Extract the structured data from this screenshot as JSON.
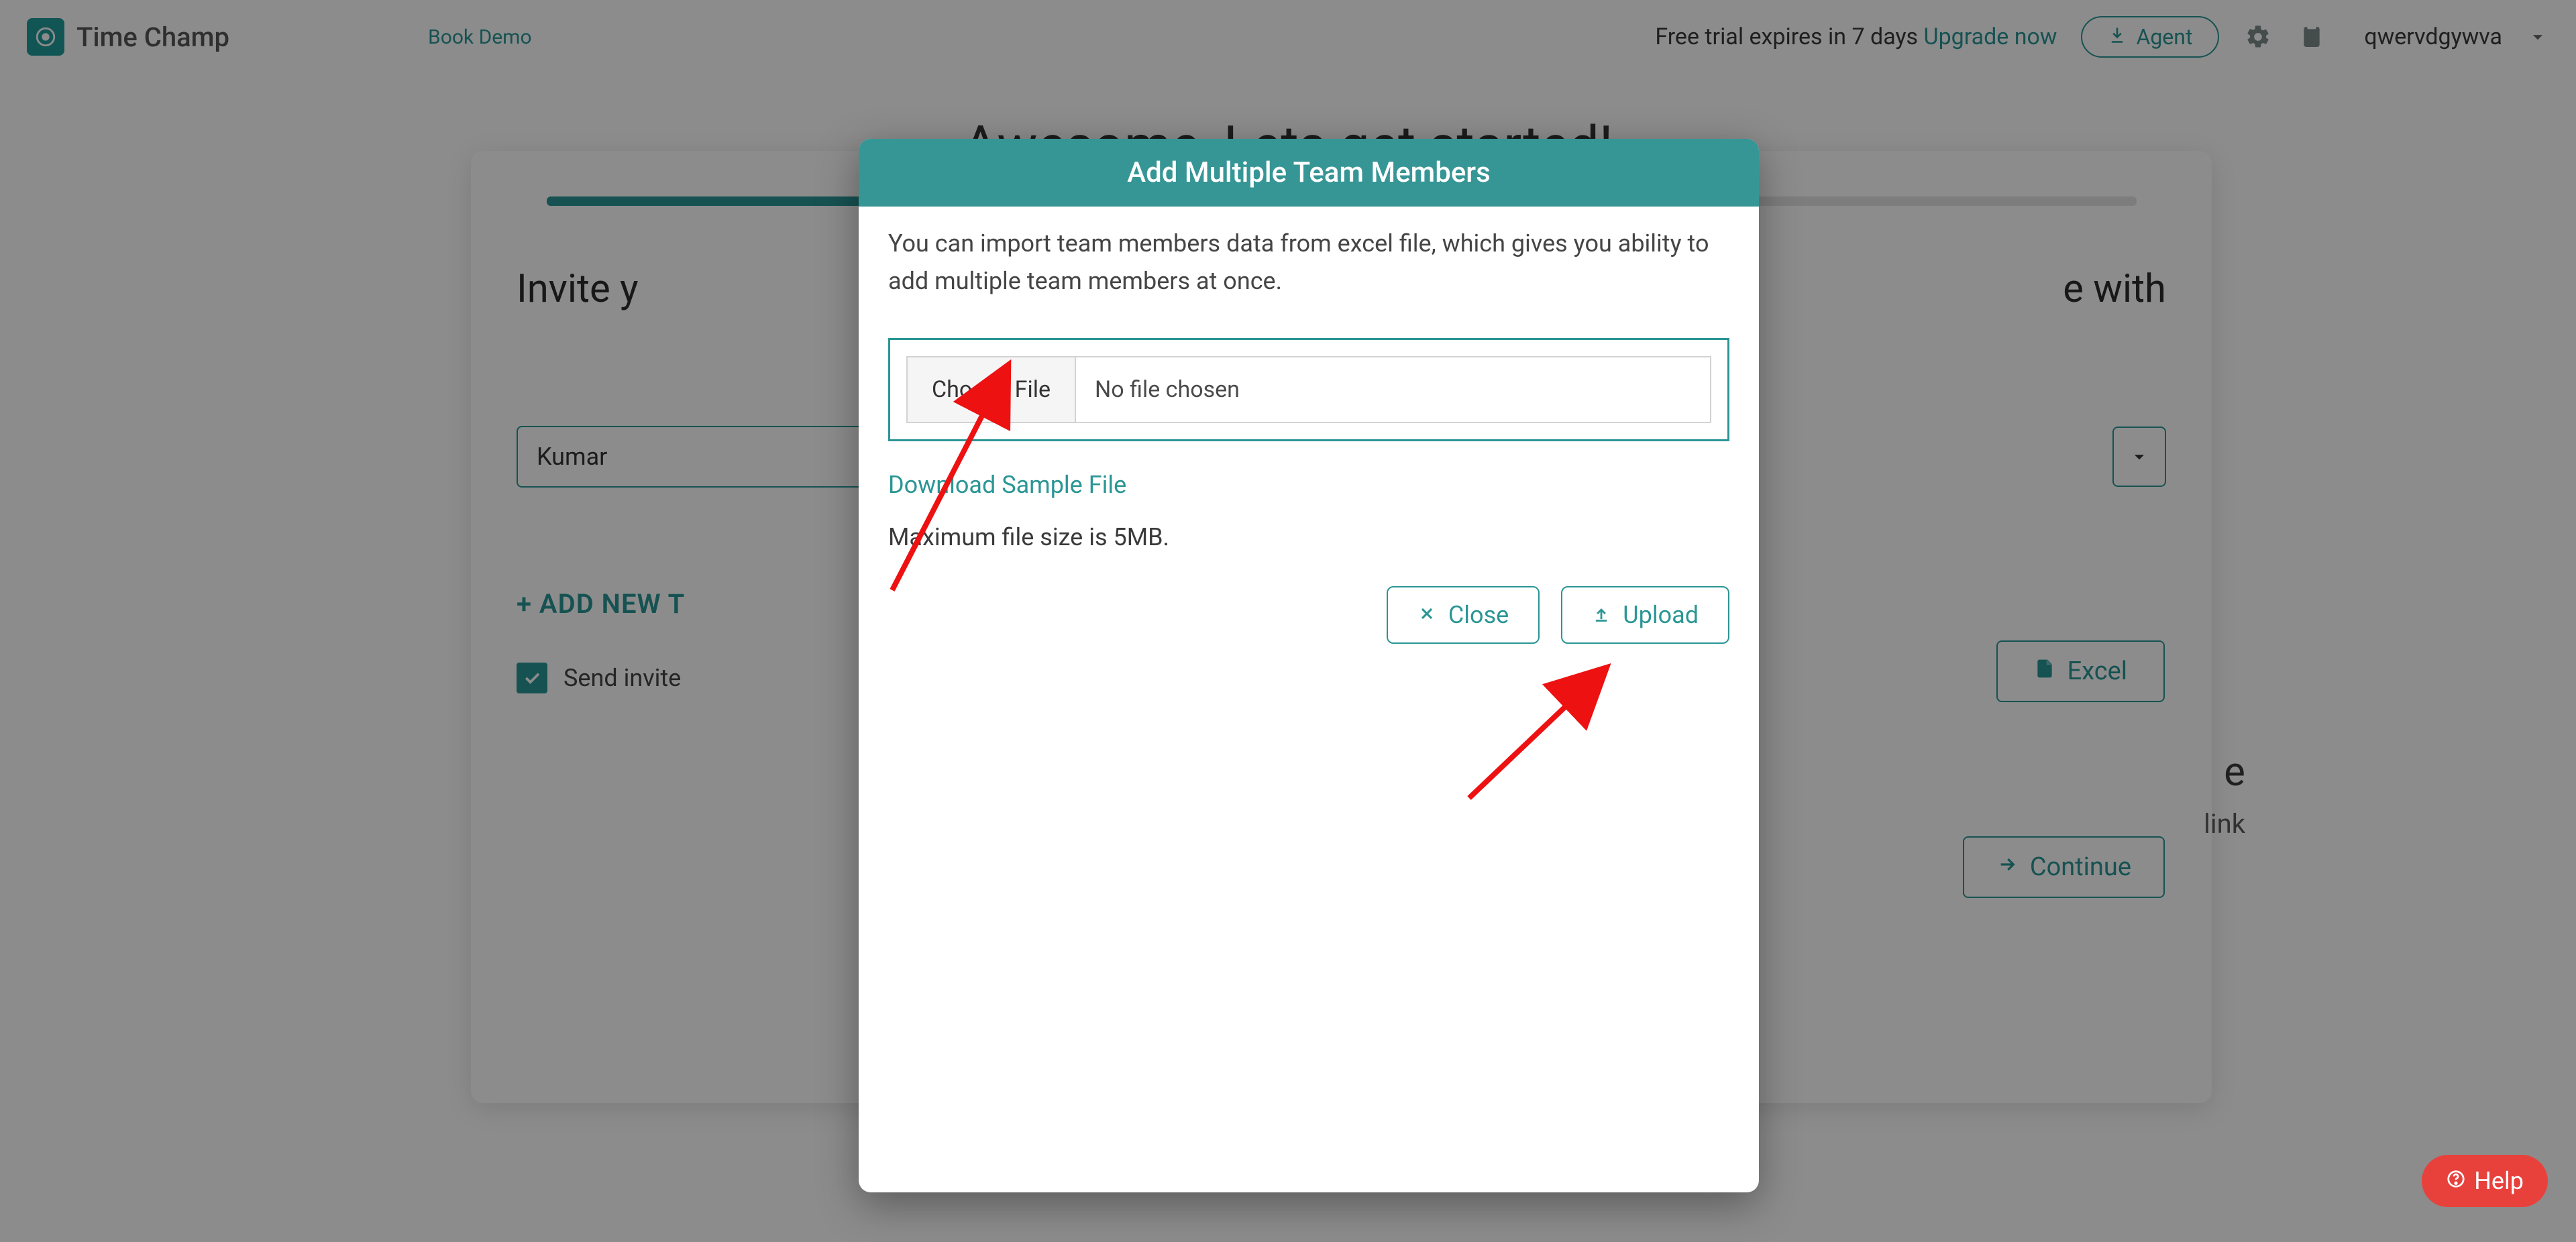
{
  "header": {
    "brand": "Time Champ",
    "book_demo": "Book Demo",
    "trial_text": "Free trial expires in 7 days ",
    "upgrade": "Upgrade now",
    "agent": "Agent",
    "user": "qwervdgywva"
  },
  "hero": "Awesome, Lets get started!",
  "card": {
    "invite_prefix": "Invite y",
    "invite_suffix": "e with",
    "team_name": "Kumar",
    "add_new": "+ ADD NEW T",
    "send_invite": "Send invite ",
    "excel": "Excel",
    "continue": "Continue",
    "side_e": "e",
    "side_link": "link"
  },
  "modal": {
    "title": "Add Multiple Team Members",
    "desc": "You can import team members data from excel file, which gives you ability to add multiple team members at once.",
    "choose": "Choose File",
    "no_file": "No file chosen",
    "sample": "Download Sample File",
    "max": "Maximum file size is 5MB.",
    "close": "Close",
    "upload": "Upload"
  },
  "help": "Help"
}
